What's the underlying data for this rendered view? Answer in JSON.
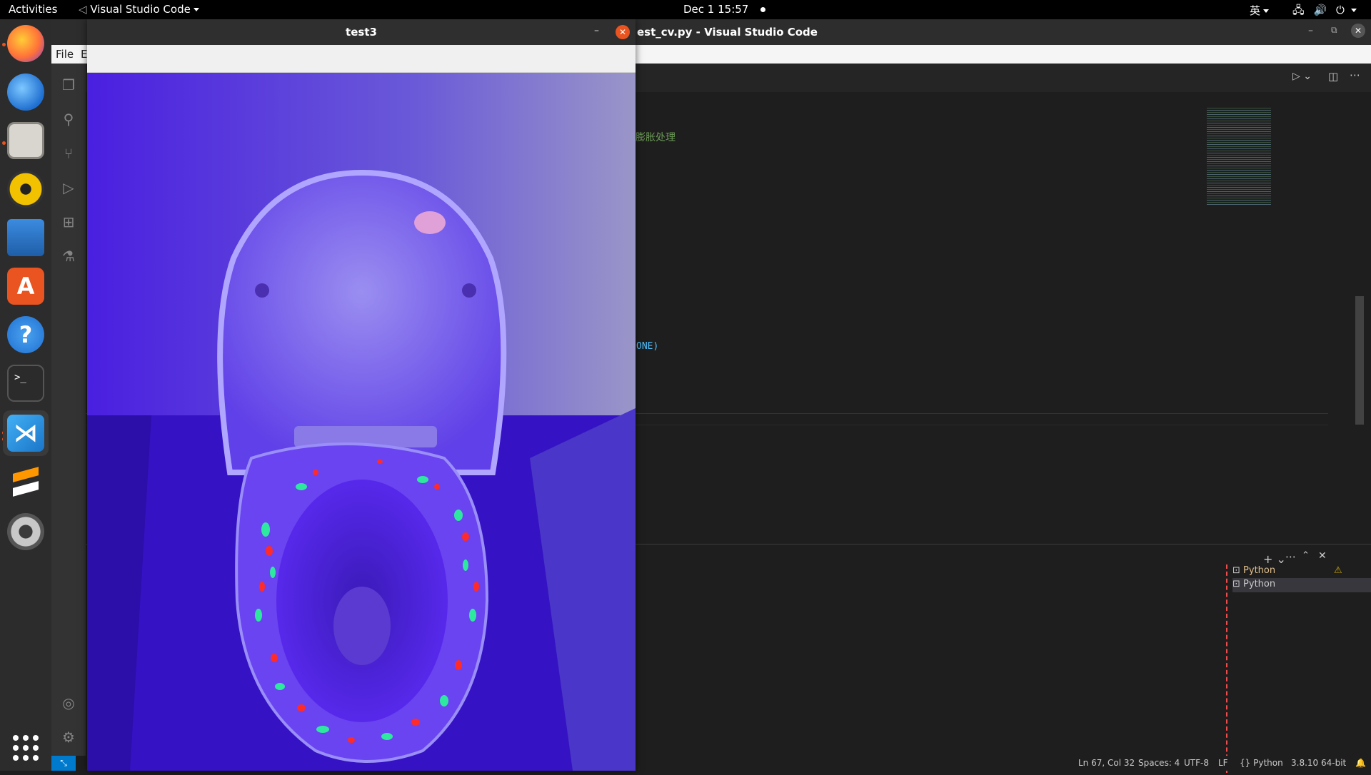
{
  "topbar": {
    "activities": "Activities",
    "app_name": "Visual Studio Code",
    "clock": "Dec 1  15:57",
    "ime": "英"
  },
  "dock": {
    "apps": [
      {
        "name": "Firefox",
        "icon": "firefox-icon",
        "color": "#ff7139"
      },
      {
        "name": "Thunderbird",
        "icon": "thunderbird-icon",
        "color": "#1f6fd1"
      },
      {
        "name": "Files",
        "icon": "files-icon",
        "color": "#d9d6cf"
      },
      {
        "name": "Rhythmbox",
        "icon": "rhythmbox-icon",
        "color": "#f2c200"
      },
      {
        "name": "LibreOffice Writer",
        "icon": "writer-icon",
        "color": "#2a72c6"
      },
      {
        "name": "Ubuntu Software",
        "icon": "software-icon",
        "color": "#e95420"
      },
      {
        "name": "Help",
        "icon": "help-icon",
        "color": "#2f86d8"
      },
      {
        "name": "Terminal",
        "icon": "terminal-icon",
        "color": "#2b2b2b"
      },
      {
        "name": "Visual Studio Code",
        "icon": "vscode-icon",
        "color": "#2a95e8"
      },
      {
        "name": "Sublime Text",
        "icon": "sublime-icon",
        "color": "#ff9800"
      },
      {
        "name": "Settings",
        "icon": "settings-icon",
        "color": "#9a9a9a"
      }
    ],
    "show_apps": "show-applications-icon"
  },
  "vscode": {
    "window_title": "test_cv.py - Visual Studio Code",
    "title_visible": "est_cv.py - Visual Studio Code",
    "menu_file": "File",
    "menu_edit_partial": "E",
    "code_comment_fragment": "膨胀处理",
    "code_fragment": "ONE)",
    "terminals": [
      "Python",
      "Python"
    ],
    "status": {
      "position": "Ln 67, Col 32",
      "spaces": "Spaces: 4",
      "encoding": "UTF-8",
      "eol": "LF",
      "language": "Python",
      "interpreter": "3.8.10 64-bit"
    }
  },
  "cv_window": {
    "title": "test3"
  },
  "colors": {
    "accent": "#007acc",
    "ubuntu_orange": "#e95420",
    "cv_close": "#e95420"
  }
}
